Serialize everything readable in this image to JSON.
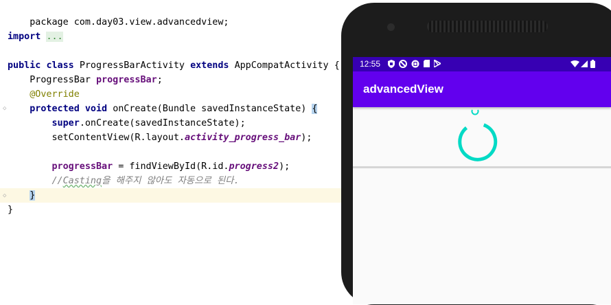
{
  "editor": {
    "lines": {
      "l1": "package com.day03.view.advancedview;",
      "l3_kw": "import",
      "l3_fold": "...",
      "l5_kw1": "public",
      "l5_kw2": "class",
      "l5_name": "ProgressBarActivity",
      "l5_kw3": "extends",
      "l5_parent": "AppCompatActivity",
      "l5_brace": "{",
      "l6_type": "ProgressBar",
      "l6_field": "progressBar",
      "l6_end": ";",
      "l7_ann": "@Override",
      "l8_kw1": "protected",
      "l8_kw2": "void",
      "l8_rest": "onCreate(Bundle savedInstanceState)",
      "l8_brace": "{",
      "l9_kw": "super",
      "l9_rest": ".onCreate(savedInstanceState);",
      "l10_a": "setContentView(R.layout.",
      "l10_ital": "activity_progress_bar",
      "l10_b": ");",
      "l12_field": "progressBar",
      "l12_a": " = findViewById(R.id.",
      "l12_ital": "progress2",
      "l12_b": ");",
      "l13_prefix": "//",
      "l13_squig": "Casting",
      "l13_rest": "을 해주지 않아도 자동으로 된다.",
      "l14_brace": "}",
      "l15": "}"
    }
  },
  "emulator": {
    "status_time": "12:55",
    "status_icons": [
      "shield-icon",
      "no-sync-icon",
      "sd-card-icon",
      "play-store-icon",
      "wifi-icon",
      "signal-icon",
      "battery-icon"
    ],
    "app_title": "advancedView",
    "colors": {
      "status_bar": "#3700b3",
      "app_bar": "#6200ee",
      "progress": "#03dac5"
    }
  }
}
